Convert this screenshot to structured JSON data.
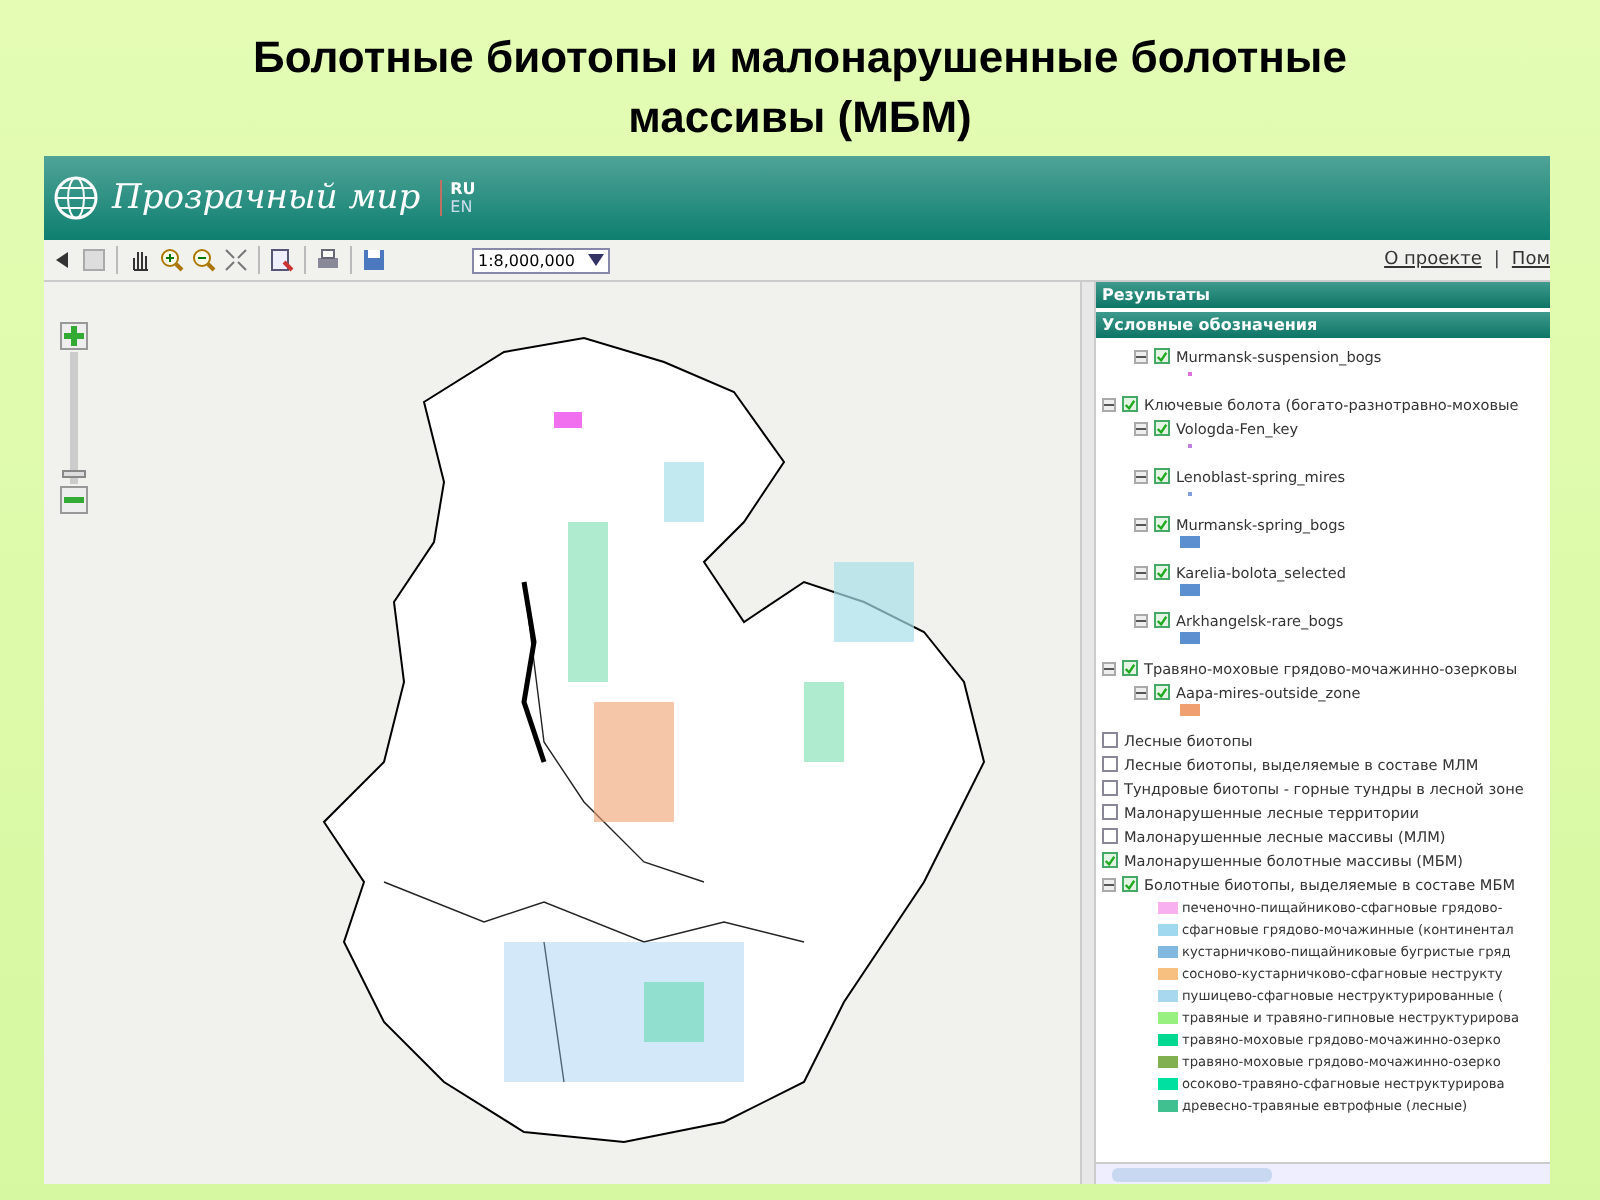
{
  "slide_title": "Болотные биотопы и малонарушенные болотные массивы (МБМ)",
  "header": {
    "logo_text": "Прозрачный мир",
    "languages": [
      {
        "label": "RU",
        "selected": true
      },
      {
        "label": "EN",
        "selected": false
      }
    ]
  },
  "toolbar": {
    "scale": "1:8,000,000",
    "links": [
      "О проекте",
      "Пом"
    ],
    "separator": "|"
  },
  "map": {
    "zoom_slider": {
      "level": 0.05
    }
  },
  "panels": [
    {
      "title": "Результаты"
    },
    {
      "title": "Условные обозначения"
    }
  ],
  "legend": {
    "items": [
      {
        "children": [
          {
            "label": "Murmansk-suspension_bogs",
            "checked": true,
            "expanded": true,
            "kind": "dot",
            "color": "#e070e0"
          }
        ]
      },
      {
        "label": "Ключевые болота (богато-разнотравно-моховые",
        "checked": true,
        "expanded": true,
        "children": [
          {
            "label": "Vologda-Fen_key",
            "checked": true,
            "expanded": true,
            "kind": "dot",
            "color": "#c080e0"
          },
          {
            "label": "Lenoblast-spring_mires",
            "checked": true,
            "expanded": true,
            "kind": "dot",
            "color": "#80a0e0"
          },
          {
            "label": "Murmansk-spring_bogs",
            "checked": true,
            "expanded": true,
            "kind": "rect",
            "color": "#5b8fd0"
          },
          {
            "label": "Karelia-bolota_selected",
            "checked": true,
            "expanded": true,
            "kind": "rect",
            "color": "#5b8fd0"
          },
          {
            "label": "Arkhangelsk-rare_bogs",
            "checked": true,
            "expanded": true,
            "kind": "rect",
            "color": "#5b8fd0"
          }
        ]
      },
      {
        "label": "Травяно-моховые грядово-мочажинно-озерковы",
        "checked": true,
        "expanded": true,
        "children": [
          {
            "label": "Aapa-mires-outside_zone",
            "checked": true,
            "expanded": true,
            "kind": "rect",
            "color": "#f0a070"
          }
        ]
      },
      {
        "label": "Лесные биотопы",
        "checked": false
      },
      {
        "label": "Лесные биотопы, выделяемые в составе МЛМ",
        "checked": false
      },
      {
        "label": "Тундровые биотопы - горные тундры в лесной зоне",
        "checked": false
      },
      {
        "label": "Малонарушенные лесные территории",
        "checked": false
      },
      {
        "label": "Малонарушенные лесные массивы (МЛМ)",
        "checked": false
      },
      {
        "label": "Малонарушенные болотные массивы (МБМ)",
        "checked": true
      },
      {
        "label": "Болотные биотопы, выделяемые в составе МБМ",
        "checked": true,
        "expanded": true,
        "classes": [
          {
            "label": "печеночно-пищайниково-сфагновые грядово-",
            "color": "#f8b0f0"
          },
          {
            "label": "сфагновые грядово-мочажинные (континентал",
            "color": "#a0d8f0"
          },
          {
            "label": "кустарничково-пищайниковые бугристые гряд",
            "color": "#80b8e0"
          },
          {
            "label": "сосново-кустарничково-сфагновые неструкту",
            "color": "#f8c080"
          },
          {
            "label": "пушицево-сфагновые неструктурированные (",
            "color": "#a8d8f0"
          },
          {
            "label": "травяные и травяно-гипновые неструктурирова",
            "color": "#98f080"
          },
          {
            "label": "травяно-моховые грядово-мочажинно-озерко",
            "color": "#00d890"
          },
          {
            "label": "травяно-моховые грядово-мочажинно-озерко",
            "color": "#80b050"
          },
          {
            "label": "осоково-травяно-сфагновые неструктурирова",
            "color": "#00e0a0"
          },
          {
            "label": "древесно-травяные евтрофные (лесные)",
            "color": "#40c090"
          }
        ]
      }
    ]
  }
}
